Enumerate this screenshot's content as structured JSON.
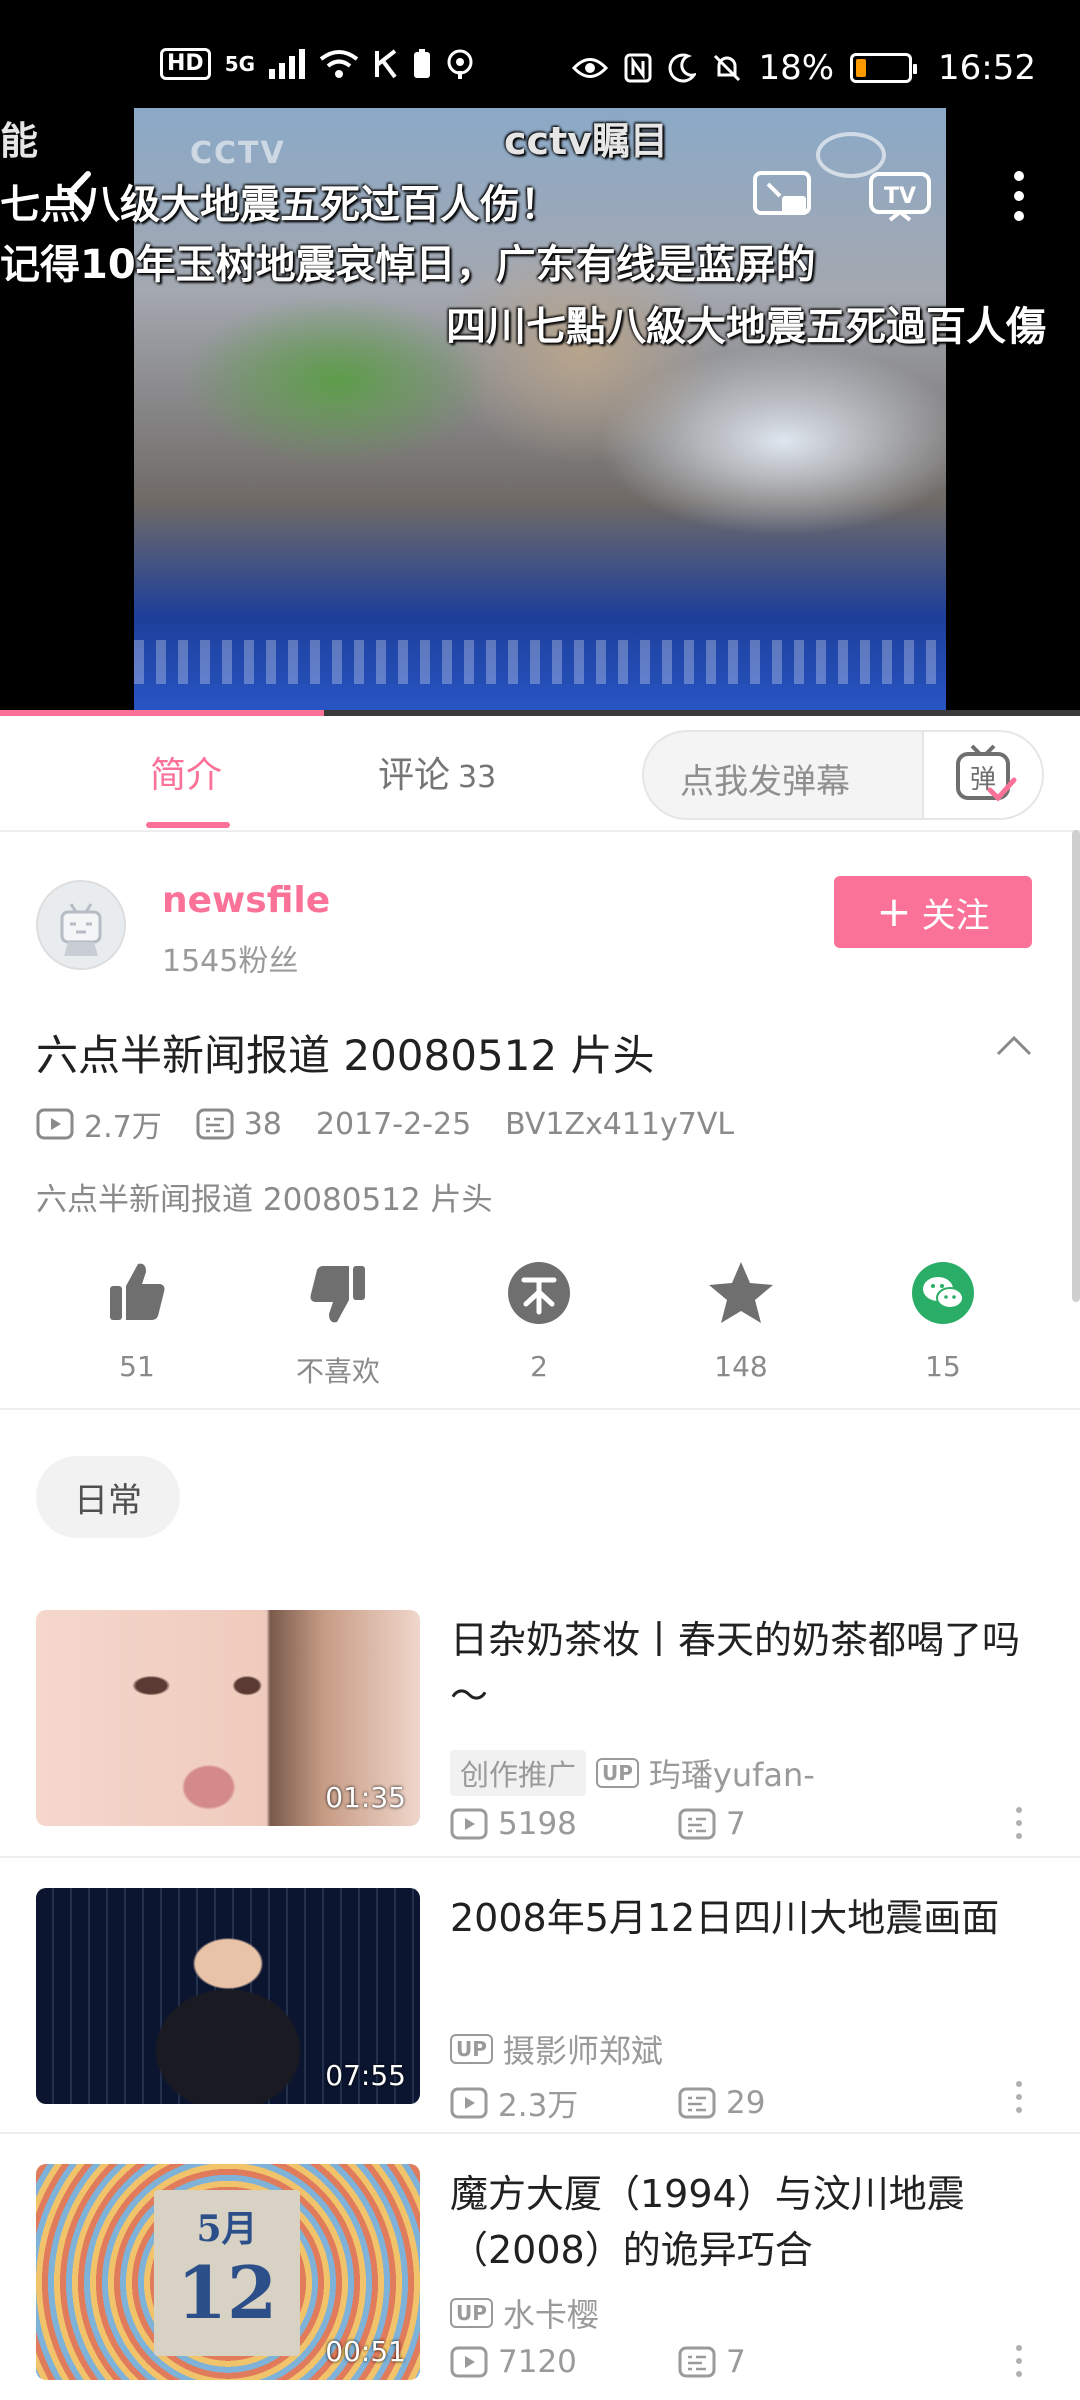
{
  "status_bar": {
    "left_badges": [
      "HD",
      "5G"
    ],
    "battery_percent": "18%",
    "time": "16:52",
    "battery_level": 0.18
  },
  "video": {
    "danmaku": [
      "能",
      "cctv瞩目",
      "七点八级大地震五死过百人伤！",
      "记得10年玉树地震哀悼日，广东有线是蓝屏的",
      "四川七點八級大地震五死過百人傷"
    ],
    "progress_fraction": 0.3
  },
  "tabs": {
    "intro": "简介",
    "comments": "评论",
    "comments_count": "33",
    "danmaku_placeholder": "点我发弹幕",
    "danmaku_button": "弹"
  },
  "uploader": {
    "name": "newsfile",
    "followers": "1545粉丝",
    "follow_label": "关注"
  },
  "info": {
    "title": "六点半新闻报道 20080512 片头",
    "views": "2.7万",
    "danmaku_count": "38",
    "date": "2017-2-25",
    "bvid": "BV1Zx411y7VL",
    "description": "六点半新闻报道 20080512 片头"
  },
  "actions": [
    {
      "label": "51"
    },
    {
      "label": "不喜欢"
    },
    {
      "label": "2"
    },
    {
      "label": "148"
    },
    {
      "label": "15"
    }
  ],
  "tag": "日常",
  "related": [
    {
      "title": "日杂奶茶妆丨春天的奶茶都喝了吗～",
      "promo": "创作推广",
      "uploader": "玙璠yufan-",
      "views": "5198",
      "comments": "7",
      "duration": "01:35"
    },
    {
      "title": "2008年5月12日四川大地震画面",
      "uploader": "摄影师郑斌",
      "views": "2.3万",
      "comments": "29",
      "duration": "07:55"
    },
    {
      "title": "魔方大厦（1994）与汶川地震（2008）的诡异巧合",
      "uploader": "水卡樱",
      "views": "7120",
      "comments": "7",
      "duration": "00:51",
      "thumb_text": [
        "5月",
        "12"
      ]
    }
  ],
  "badges": {
    "up": "UP",
    "tv": "TV"
  },
  "colors": {
    "accent": "#fb7299",
    "wechat": "#2aae67",
    "icon_gray": "#6f6f6f"
  }
}
